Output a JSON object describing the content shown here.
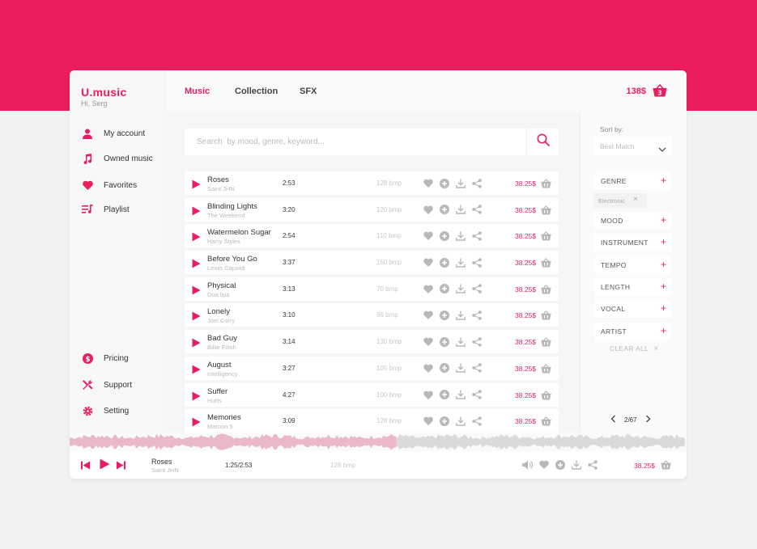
{
  "brand": {
    "name": "U.music",
    "greeting": "Hi, Serg"
  },
  "colors": {
    "accent": "#ec1d5d",
    "muted": "#b8b8b8"
  },
  "nav_top": [
    {
      "label": "My account",
      "icon": "user-icon"
    },
    {
      "label": "Owned music",
      "icon": "music-note-icon"
    },
    {
      "label": "Favorites",
      "icon": "heart-icon"
    },
    {
      "label": "Playlist",
      "icon": "playlist-icon"
    }
  ],
  "nav_bottom": [
    {
      "label": "Pricing",
      "icon": "dollar-icon"
    },
    {
      "label": "Support",
      "icon": "tools-icon"
    },
    {
      "label": "Setting",
      "icon": "gear-icon"
    }
  ],
  "tabs": [
    {
      "label": "Music",
      "active": true
    },
    {
      "label": "Collection",
      "active": false
    },
    {
      "label": "SFX",
      "active": false
    }
  ],
  "cart": {
    "total": "138$",
    "count": "3"
  },
  "search": {
    "placeholder": "Search  by mood, genre, keyword..."
  },
  "tracks": [
    {
      "title": "Roses",
      "artist": "Saint JHN",
      "duration": "2:53",
      "bpm": "128 bmp",
      "price": "38.25$"
    },
    {
      "title": "Blinding Lights",
      "artist": "The Weekend",
      "duration": "3:20",
      "bpm": "120 bmp",
      "price": "38.25$"
    },
    {
      "title": "Watermelon Sugar",
      "artist": "Harry Styles",
      "duration": "2:54",
      "bpm": "110 bmp",
      "price": "38.25$"
    },
    {
      "title": "Before You Go",
      "artist": "Lewis Capaldi",
      "duration": "3:37",
      "bpm": "150 bmp",
      "price": "38.25$"
    },
    {
      "title": "Physical",
      "artist": "Dua lipa",
      "duration": "3:13",
      "bpm": "70 bmp",
      "price": "38.25$"
    },
    {
      "title": "Lonely",
      "artist": "Joel Corry",
      "duration": "3:10",
      "bpm": "96 bmp",
      "price": "38.25$"
    },
    {
      "title": "Bad Guy",
      "artist": "Billie Eilish",
      "duration": "3:14",
      "bpm": "130 bmp",
      "price": "38.25$"
    },
    {
      "title": "August",
      "artist": "Intelligency",
      "duration": "3:27",
      "bpm": "105 bmp",
      "price": "38.25$"
    },
    {
      "title": "Suffer",
      "artist": "Hurts",
      "duration": "4:27",
      "bpm": "100 bmp",
      "price": "38.25$"
    },
    {
      "title": "Memories",
      "artist": "Maroon 5",
      "duration": "3:09",
      "bpm": "128 bmp",
      "price": "38.25$"
    }
  ],
  "sort": {
    "label": "Sort by:",
    "value": "Best Match"
  },
  "filters": [
    {
      "label": "GENRE"
    },
    {
      "label": "MOOD"
    },
    {
      "label": "INSTRUMENT"
    },
    {
      "label": "TEMPO"
    },
    {
      "label": "LENGTH"
    },
    {
      "label": "VOCAL"
    },
    {
      "label": "ARTIST"
    }
  ],
  "active_filter": {
    "label": "Electronic"
  },
  "clear_all": "CLEAR ALL",
  "pagination": {
    "text": "2/67"
  },
  "player": {
    "title": "Roses",
    "artist": "Saint JHN",
    "time": "1:25/2:53",
    "bpm": "128 bmp",
    "price": "38.25$",
    "progress": 0.53
  }
}
